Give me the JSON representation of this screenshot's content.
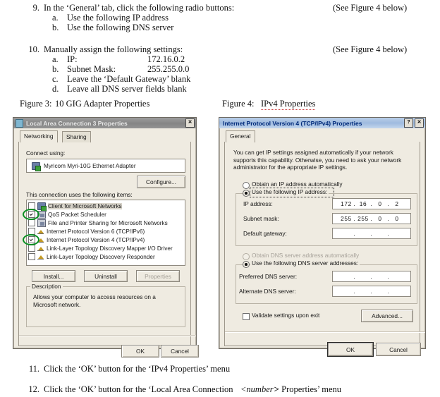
{
  "document": {
    "steps": [
      {
        "number": "9.",
        "text": "In the ‘General’ tab, click the following radio buttons:",
        "note": "(See Figure 4 below)",
        "subitems": [
          {
            "letter": "a.",
            "text": "Use the following IP address"
          },
          {
            "letter": "b.",
            "text": "Use the following DNS server"
          }
        ]
      },
      {
        "number": "10.",
        "text": "Manually assign the following settings:",
        "note": "(See Figure 4 below)",
        "subitems": [
          {
            "letter": "a.",
            "text": "IP:",
            "value": "172.16.0.2"
          },
          {
            "letter": "b.",
            "text": "Subnet Mask:",
            "value": "255.255.0.0"
          },
          {
            "letter": "c.",
            "text": "Leave the ‘Default Gateway’ blank",
            "value": ""
          },
          {
            "letter": "d.",
            "text": "Leave all DNS server fields blank",
            "value": ""
          }
        ]
      }
    ],
    "figure_captions": [
      {
        "label": "Figure 3:",
        "title": "10 GIG Adapter Properties"
      },
      {
        "label": "Figure 4:",
        "title": "IPv4 Properties"
      }
    ],
    "trailing_steps": [
      {
        "number": "11.",
        "pre": "Click the ‘OK’ button for the ‘IPv4 Properties’ menu"
      },
      {
        "number": "12.",
        "pre": "Click the ‘OK’ button for the ‘Local Area Connection ",
        "em": "<number>",
        "post": "> Properties’ menu"
      }
    ]
  },
  "adapter_dialog": {
    "title": "Local Area Connection 3 Properties",
    "close_label": "✕",
    "tabs": [
      {
        "label": "Networking",
        "selected": true
      },
      {
        "label": "Sharing",
        "selected": false
      }
    ],
    "connect_using_label": "Connect using:",
    "adapter_name": "Myricom Myri-10G Ethernet Adapter",
    "configure_button": "Configure...",
    "items_label": "This connection uses the following items:",
    "items": [
      {
        "label": "Client for Microsoft Networks",
        "checked": false,
        "icon": "network-client-icon",
        "highlighted": false,
        "selected": true
      },
      {
        "label": "QoS Packet Scheduler",
        "checked": true,
        "icon": "service-icon",
        "highlighted": true,
        "selected": false
      },
      {
        "label": "File and Printer Sharing for Microsoft Networks",
        "checked": false,
        "icon": "service-icon",
        "highlighted": false,
        "selected": false
      },
      {
        "label": "Internet Protocol Version 6 (TCP/IPv6)",
        "checked": false,
        "icon": "protocol-icon",
        "highlighted": false,
        "selected": false
      },
      {
        "label": "Internet Protocol Version 4 (TCP/IPv4)",
        "checked": true,
        "icon": "protocol-icon",
        "highlighted": true,
        "selected": false
      },
      {
        "label": "Link-Layer Topology Discovery Mapper I/O Driver",
        "checked": false,
        "icon": "protocol-icon",
        "highlighted": false,
        "selected": false
      },
      {
        "label": "Link-Layer Topology Discovery Responder",
        "checked": false,
        "icon": "protocol-icon",
        "highlighted": false,
        "selected": false
      }
    ],
    "install_button": "Install...",
    "uninstall_button": "Uninstall",
    "properties_button": "Properties",
    "description_legend": "Description",
    "description_text": "Allows your computer to access resources on a Microsoft network.",
    "ok_button": "OK",
    "cancel_button": "Cancel"
  },
  "ipv4_dialog": {
    "title": "Internet Protocol Version 4 (TCP/IPv4) Properties",
    "help_label": "?",
    "close_label": "✕",
    "tabs": [
      {
        "label": "General",
        "selected": true
      }
    ],
    "intro": "You can get IP settings assigned automatically if your network supports this capability. Otherwise, you need to ask your network administrator for the appropriate IP settings.",
    "radio_obtain_ip": {
      "label": "Obtain an IP address automatically",
      "selected": false
    },
    "radio_use_ip": {
      "label": "Use the following IP address:",
      "selected": true
    },
    "ip_address": {
      "label": "IP address:",
      "octets": [
        "172",
        "16",
        "0",
        "2"
      ]
    },
    "subnet_mask": {
      "label": "Subnet mask:",
      "octets": [
        "255",
        "255",
        "0",
        "0"
      ]
    },
    "default_gateway": {
      "label": "Default gateway:",
      "octets": [
        "",
        "",
        "",
        ""
      ]
    },
    "radio_obtain_dns": {
      "label": "Obtain DNS server address automatically",
      "selected": false,
      "disabled": true
    },
    "radio_use_dns": {
      "label": "Use the following DNS server addresses:",
      "selected": true
    },
    "preferred_dns": {
      "label": "Preferred DNS server:",
      "octets": [
        "",
        "",
        "",
        ""
      ]
    },
    "alternate_dns": {
      "label": "Alternate DNS server:",
      "octets": [
        "",
        "",
        "",
        ""
      ]
    },
    "validate_checkbox": {
      "label": "Validate settings upon exit",
      "checked": false
    },
    "advanced_button": "Advanced...",
    "ok_button": "OK",
    "cancel_button": "Cancel"
  },
  "colors": {
    "dialog_face": "#efebe1",
    "left_titlebar": "#8d8d8d",
    "right_titlebar": "#a8c2e2",
    "right_title_text": "#002a7a",
    "highlight_ring": "#0a8f23"
  }
}
